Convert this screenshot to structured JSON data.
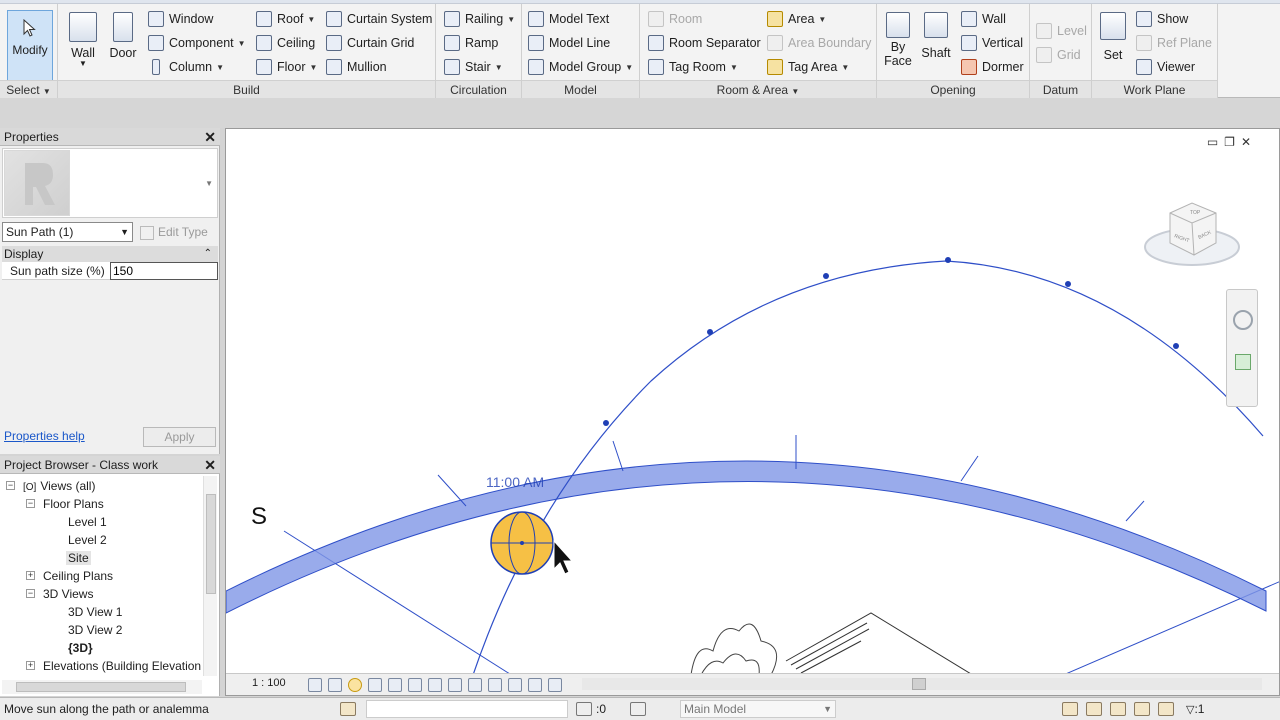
{
  "ribbon": {
    "modify_label": "Modify",
    "select_label": "Select",
    "build": {
      "panel_label": "Build",
      "wall": "Wall",
      "door": "Door",
      "window": "Window",
      "component": "Component",
      "column": "Column",
      "roof": "Roof",
      "ceiling": "Ceiling",
      "floor": "Floor",
      "curtain_system": "Curtain System",
      "curtain_grid": "Curtain Grid",
      "mullion": "Mullion"
    },
    "circulation": {
      "panel_label": "Circulation",
      "railing": "Railing",
      "ramp": "Ramp",
      "stair": "Stair"
    },
    "model": {
      "panel_label": "Model",
      "model_text": "Model Text",
      "model_line": "Model Line",
      "model_group": "Model Group"
    },
    "room_area": {
      "panel_label": "Room & Area",
      "room": "Room",
      "room_separator": "Room Separator",
      "tag_room": "Tag Room",
      "area": "Area",
      "area_boundary": "Area Boundary",
      "tag_area": "Tag Area"
    },
    "opening": {
      "panel_label": "Opening",
      "by_face_1": "By",
      "by_face_2": "Face",
      "shaft": "Shaft",
      "wall": "Wall",
      "vertical": "Vertical",
      "dormer": "Dormer"
    },
    "datum": {
      "panel_label": "Datum",
      "level": "Level",
      "grid": "Grid"
    },
    "work_plane": {
      "panel_label": "Work Plane",
      "set": "Set",
      "show": "Show",
      "ref_plane": "Ref Plane",
      "viewer": "Viewer"
    }
  },
  "properties": {
    "title": "Properties",
    "type_selector": "Sun Path (1)",
    "edit_type": "Edit Type",
    "group": "Display",
    "param_label": "Sun path size (%)",
    "param_value": "150",
    "help": "Properties help",
    "apply": "Apply"
  },
  "browser": {
    "title": "Project Browser - Class work",
    "views_all": "Views (all)",
    "floor_plans": "Floor Plans",
    "level1": "Level 1",
    "level2": "Level 2",
    "site": "Site",
    "ceiling_plans": "Ceiling Plans",
    "views_3d": "3D Views",
    "view1": "3D View 1",
    "view2": "3D View 2",
    "view3d": "{3D}",
    "elevations": "Elevations (Building Elevation"
  },
  "viewport": {
    "compass_s": "S",
    "time_label": "11:00 AM",
    "scale": "1 : 100",
    "viewcube_top": "TOP",
    "viewcube_right": "RIGHT",
    "viewcube_back": "BACK"
  },
  "status": {
    "message": "Move sun along the path or analemma",
    "zero": ":0",
    "model": "Main Model",
    "filter": ":1"
  },
  "colors": {
    "accent_blue": "#1f3fb5",
    "sun_yellow": "#f6c045",
    "ribbon_bg": "#f3f3f3"
  }
}
